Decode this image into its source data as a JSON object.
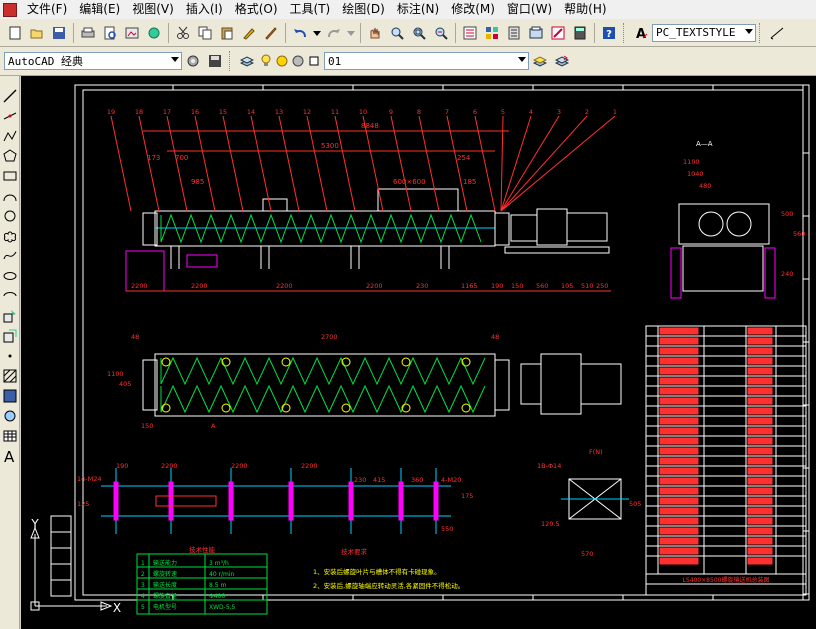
{
  "menubar": {
    "items": [
      "文件(F)",
      "编辑(E)",
      "视图(V)",
      "插入(I)",
      "格式(O)",
      "工具(T)",
      "绘图(D)",
      "标注(N)",
      "修改(M)",
      "窗口(W)",
      "帮助(H)"
    ]
  },
  "toolbar": {
    "text_style": "PC_TEXTSTYLE",
    "workspace": "AutoCAD 经典",
    "layer": "01"
  },
  "drawing": {
    "dims_top": [
      "8848",
      "5300",
      "173",
      "700",
      "985",
      "254",
      "185",
      "600×600"
    ],
    "dims_bottom_row": [
      "2200",
      "2200",
      "2200",
      "2200",
      "230",
      "1165",
      "190",
      "150",
      "560",
      "105",
      "510",
      "250"
    ],
    "dims_section": [
      "1100",
      "1040",
      "480",
      "500",
      "560",
      "240"
    ],
    "dims_plan": [
      "48",
      "2700",
      "405",
      "1100",
      "150",
      "48",
      "A"
    ],
    "dims_foundation": [
      "14-M24",
      "190",
      "2200",
      "2200",
      "2200",
      "230",
      "415",
      "360",
      "4-M20",
      "175",
      "125",
      "550"
    ],
    "dims_flange": [
      "1B-Φ14",
      "F(N)",
      "570",
      "505",
      "120.5"
    ],
    "section_label": "A—A",
    "spec_title": "技术性能",
    "spec_rows": [
      [
        "1",
        "输送能力",
        "3 m³/h"
      ],
      [
        "2",
        "螺旋转速",
        "40 r/min"
      ],
      [
        "3",
        "输送长度",
        "8.5 m"
      ],
      [
        "4",
        "螺旋直径",
        "Φ400"
      ],
      [
        "5",
        "电机型号",
        "XWD-5.5"
      ]
    ],
    "notes_title": "技术要求",
    "notes": [
      "1、安装后螺旋叶片与槽体不得有卡碰现象。",
      "2、安装后,螺旋轴端应转动灵活,各紧固件不得松动。"
    ],
    "title_block": "LS400×8500螺旋输送机总装图",
    "balloons": [
      "19",
      "18",
      "17",
      "16",
      "15",
      "14",
      "13",
      "12",
      "11",
      "10",
      "9",
      "8",
      "7",
      "6",
      "5",
      "4",
      "3",
      "2",
      "1"
    ],
    "ucs_x": "X",
    "ucs_y": "Y"
  },
  "colors": {
    "canvas": "#000000",
    "frame": "#ffffff",
    "dim": "#ff3030",
    "equipment": "#ffffff",
    "flight": "#00e040",
    "hidden": "#00d0ff",
    "layer_magenta": "#ff00ff",
    "table_line": "#ffffff",
    "yellow": "#ffff00"
  }
}
